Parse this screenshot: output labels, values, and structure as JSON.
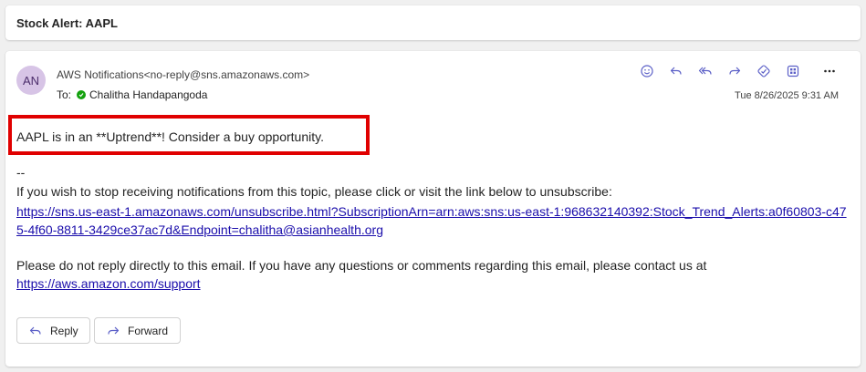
{
  "subject": "Stock Alert: AAPL",
  "message": {
    "avatar_initials": "AN",
    "sender": "AWS Notifications<no-reply@sns.amazonaws.com>",
    "to_label": "To:",
    "recipient": "Chalitha Handapangoda",
    "timestamp": "Tue 8/26/2025 9:31 AM",
    "alert_text": "AAPL is in an **Uptrend**! Consider a buy opportunity.",
    "separator": "--",
    "unsubscribe_text": "If you wish to stop receiving notifications from this topic, please click or visit the link below to unsubscribe:",
    "unsubscribe_link": "https://sns.us-east-1.amazonaws.com/unsubscribe.html?SubscriptionArn=arn:aws:sns:us-east-1:968632140392:Stock_Trend_Alerts:a0f60803-c475-4f60-8811-3429ce37ac7d&Endpoint=chalitha@asianhealth.org",
    "noreply_text": "Please do not reply directly to this email. If you have any questions or comments regarding this email, please contact us at",
    "support_link": "https://aws.amazon.com/support"
  },
  "actions": {
    "reply_label": "Reply",
    "forward_label": "Forward"
  },
  "toolbar_icons": [
    "emoji-icon",
    "reply-icon",
    "reply-all-icon",
    "forward-icon",
    "copilot-icon",
    "apps-icon",
    "more-icon"
  ],
  "colors": {
    "accent": "#5b5fc7",
    "link": "#1a0dab",
    "highlight_border": "#e00000",
    "avatar_bg": "#d7c4e6",
    "presence_green": "#13a10e"
  }
}
